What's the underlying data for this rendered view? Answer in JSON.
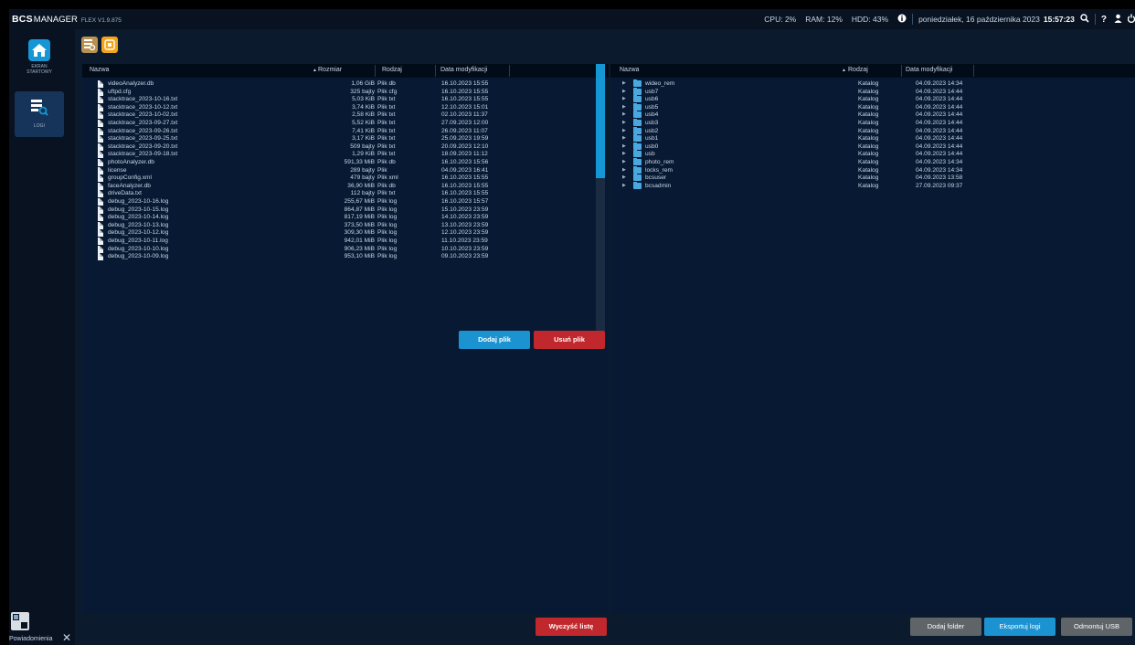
{
  "app": {
    "brand_bcs": "BCS",
    "brand_manager": "MANAGER",
    "version": "FLEX V1.9.875"
  },
  "status": {
    "cpu_label": "CPU:",
    "cpu_value": "2%",
    "ram_label": "RAM:",
    "ram_value": "12%",
    "hdd_label": "HDD:",
    "hdd_value": "43%",
    "date": "poniedziałek, 16 października 2023",
    "time": "15:57:23"
  },
  "nav": {
    "home_label_1": "EKRAN",
    "home_label_2": "STARTOWY",
    "logs_label": "LOGI"
  },
  "notifications": {
    "label": "Powiadomienia"
  },
  "left_table": {
    "col_name": "Nazwa",
    "col_size": "Rozmiar",
    "col_type": "Rodzaj",
    "col_date": "Data modyfikacji",
    "sort_indicator": "▲",
    "rows": [
      {
        "name": "videoAnalyzer.db",
        "size": "1,06 GiB",
        "type": "Plik db",
        "date": "16.10.2023 15:55"
      },
      {
        "name": "uftpd.cfg",
        "size": "325 bajty",
        "type": "Plik cfg",
        "date": "16.10.2023 15:55"
      },
      {
        "name": "stacktrace_2023-10-16.txt",
        "size": "5,03 KiB",
        "type": "Plik txt",
        "date": "16.10.2023 15:55"
      },
      {
        "name": "stacktrace_2023-10-12.txt",
        "size": "3,74 KiB",
        "type": "Plik txt",
        "date": "12.10.2023 15:01"
      },
      {
        "name": "stacktrace_2023-10-02.txt",
        "size": "2,58 KiB",
        "type": "Plik txt",
        "date": "02.10.2023 11:37"
      },
      {
        "name": "stacktrace_2023-09-27.txt",
        "size": "5,52 KiB",
        "type": "Plik txt",
        "date": "27.09.2023 12:00"
      },
      {
        "name": "stacktrace_2023-09-26.txt",
        "size": "7,41 KiB",
        "type": "Plik txt",
        "date": "26.09.2023 11:07"
      },
      {
        "name": "stacktrace_2023-09-25.txt",
        "size": "3,17 KiB",
        "type": "Plik txt",
        "date": "25.09.2023 19:59"
      },
      {
        "name": "stacktrace_2023-09-20.txt",
        "size": "509 bajty",
        "type": "Plik txt",
        "date": "20.09.2023 12:10"
      },
      {
        "name": "stacktrace_2023-09-18.txt",
        "size": "1,29 KiB",
        "type": "Plik txt",
        "date": "18.09.2023 11:12"
      },
      {
        "name": "photoAnalyzer.db",
        "size": "591,33 MiB",
        "type": "Plik db",
        "date": "16.10.2023 15:56"
      },
      {
        "name": "license",
        "size": "289 bajty",
        "type": "Plik",
        "date": "04.09.2023 16:41"
      },
      {
        "name": "groupConfig.xml",
        "size": "479 bajty",
        "type": "Plik xml",
        "date": "16.10.2023 15:55"
      },
      {
        "name": "faceAnalyzer.db",
        "size": "36,90 MiB",
        "type": "Plik db",
        "date": "16.10.2023 15:55"
      },
      {
        "name": "driveData.txt",
        "size": "112 bajty",
        "type": "Plik txt",
        "date": "16.10.2023 15:55"
      },
      {
        "name": "debug_2023-10-16.log",
        "size": "255,67 MiB",
        "type": "Plik log",
        "date": "16.10.2023 15:57"
      },
      {
        "name": "debug_2023-10-15.log",
        "size": "864,87 MiB",
        "type": "Plik log",
        "date": "15.10.2023 23:59"
      },
      {
        "name": "debug_2023-10-14.log",
        "size": "817,19 MiB",
        "type": "Plik log",
        "date": "14.10.2023 23:59"
      },
      {
        "name": "debug_2023-10-13.log",
        "size": "373,50 MiB",
        "type": "Plik log",
        "date": "13.10.2023 23:59"
      },
      {
        "name": "debug_2023-10-12.log",
        "size": "309,30 MiB",
        "type": "Plik log",
        "date": "12.10.2023 23:59"
      },
      {
        "name": "debug_2023-10-11.log",
        "size": "942,01 MiB",
        "type": "Plik log",
        "date": "11.10.2023 23:59"
      },
      {
        "name": "debug_2023-10-10.log",
        "size": "906,23 MiB",
        "type": "Plik log",
        "date": "10.10.2023 23:59"
      },
      {
        "name": "debug_2023-10-09.log",
        "size": "953,10 MiB",
        "type": "Plik log",
        "date": "09.10.2023 23:59"
      }
    ]
  },
  "right_table": {
    "col_name": "Nazwa",
    "col_type": "Rodzaj",
    "col_date": "Data modyfikacji",
    "sort_indicator": "▲",
    "rows": [
      {
        "name": "wideo_rem",
        "type": "Katalog",
        "date": "04.09.2023 14:34"
      },
      {
        "name": "usb7",
        "type": "Katalog",
        "date": "04.09.2023 14:44"
      },
      {
        "name": "usb6",
        "type": "Katalog",
        "date": "04.09.2023 14:44"
      },
      {
        "name": "usb5",
        "type": "Katalog",
        "date": "04.09.2023 14:44"
      },
      {
        "name": "usb4",
        "type": "Katalog",
        "date": "04.09.2023 14:44"
      },
      {
        "name": "usb3",
        "type": "Katalog",
        "date": "04.09.2023 14:44"
      },
      {
        "name": "usb2",
        "type": "Katalog",
        "date": "04.09.2023 14:44"
      },
      {
        "name": "usb1",
        "type": "Katalog",
        "date": "04.09.2023 14:44"
      },
      {
        "name": "usb0",
        "type": "Katalog",
        "date": "04.09.2023 14:44"
      },
      {
        "name": "usb",
        "type": "Katalog",
        "date": "04.09.2023 14:44"
      },
      {
        "name": "photo_rem",
        "type": "Katalog",
        "date": "04.09.2023 14:34"
      },
      {
        "name": "locks_rem",
        "type": "Katalog",
        "date": "04.09.2023 14:34"
      },
      {
        "name": "bcsuser",
        "type": "Katalog",
        "date": "04.09.2023 13:58"
      },
      {
        "name": "bcsadmin",
        "type": "Katalog",
        "date": "27.09.2023 09:37"
      }
    ]
  },
  "buttons": {
    "add_file": "Dodaj plik",
    "delete_file": "Usuń plik",
    "clear_list": "Wyczyść listę",
    "add_folder": "Dodaj folder",
    "export_logs": "Eksportuj logi",
    "unmount_usb": "Odmontuj USB"
  },
  "icons": {
    "topbar": [
      "info-icon",
      "pin-icon",
      "help-icon",
      "user-icon",
      "power-icon"
    ],
    "nav": [
      "home-icon",
      "logs-icon"
    ],
    "toolbar": [
      "log-viewer-icon",
      "export-icon"
    ]
  },
  "colors": {
    "accent_blue": "#1b93d1",
    "danger_red": "#c0282d",
    "neutral_gray": "#5f6468",
    "background": "#0c1a2e"
  }
}
